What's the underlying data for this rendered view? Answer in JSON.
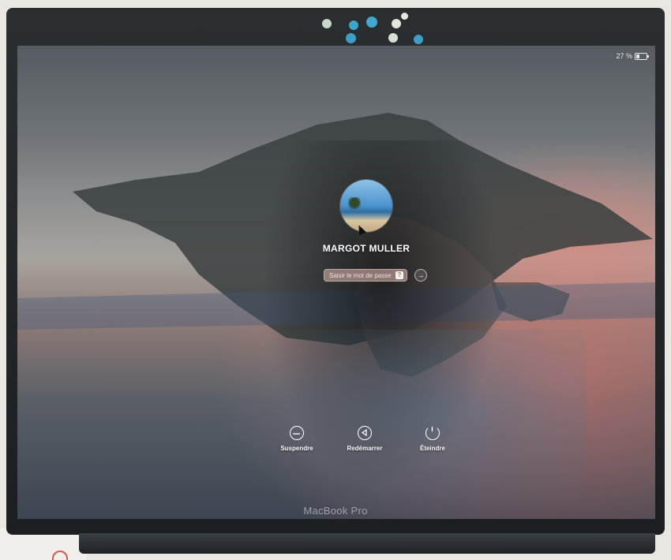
{
  "status_bar": {
    "battery_text": "27 %"
  },
  "user": {
    "name": "MARGOT MULLER"
  },
  "password": {
    "placeholder": "Saisir le mot de passe",
    "hint_label": "?",
    "submit_glyph": "→"
  },
  "power_actions": [
    {
      "label": "Suspendre",
      "icon": "sleep-icon"
    },
    {
      "label": "Redémarrer",
      "icon": "restart-icon"
    },
    {
      "label": "Éteindre",
      "icon": "power-icon"
    }
  ],
  "device": {
    "name": "MacBook Pro"
  },
  "colors": {
    "accent_pink": "#e9847a",
    "bezel": "#1c1f22",
    "text": "#ffffff"
  }
}
